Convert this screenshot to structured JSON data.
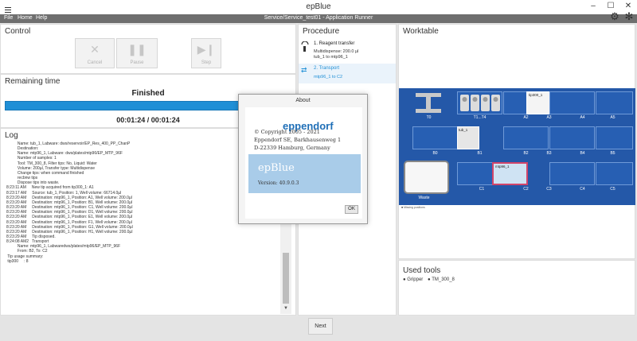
{
  "window": {
    "title": "epBlue",
    "subtitle": "Service/Service_test01 - Application Runner",
    "min": "–",
    "max": "☐",
    "close": "✕"
  },
  "menu": [
    "File",
    "Home",
    "Help"
  ],
  "toolbar_right": {
    "icon1": "run-settings-icon",
    "icon2": "fan-icon"
  },
  "control": {
    "title": "Control",
    "cancel_label": "Cancel",
    "pause_label": "Pause",
    "step_label": "Step"
  },
  "remaining": {
    "title": "Remaining time",
    "status": "Finished",
    "progress": 1.0,
    "times": "00:01:24  /  00:01:24"
  },
  "log": {
    "title": "Log",
    "lines": [
      "          Name: tub_1, Labware: dws/reservoir/EP_Res_400_PP_ChanP",
      "          Destination:",
      "          Name: mtp96_1, Labware: dws/plates/mtp96/EP_MTP_96F",
      "          Number of samples: 1",
      "          Tool: TM_300_8, Filter tips: No, Liquid: Water",
      "          Volume: 200µl, Transfer type: Multidispense",
      "          Change tips: when command finished",
      "          recbnw tips",
      "          Dispose tips into waste.",
      "8:23:11 AM     New tip acquired from tip300_1: A1",
      "8:23:17 AM     Source: tub_1, Position: 1, Well volume: 66714.0µl",
      "8:23:20 AM     Destination: mtp96_1, Position: A1, Well volume: 200.0µl",
      "8:23:20 AM     Destination: mtp96_1, Position: B1, Well volume: 200.0µl",
      "8:23:20 AM     Destination: mtp96_1, Position: C1, Well volume: 200.0µl",
      "8:23:20 AM     Destination: mtp96_1, Position: D1, Well volume: 200.0µl",
      "8:23:20 AM     Destination: mtp96_1, Position: E1, Well volume: 200.0µl",
      "8:23:20 AM     Destination: mtp96_1, Position: F1, Well volume: 200.0µl",
      "8:23:20 AM     Destination: mtp96_1, Position: G1, Well volume: 200.0µl",
      "8:23:20 AM     Destination: mtp96_1, Position: H1, Well volume: 200.0µl",
      "8:23:29 AM     Tip disposed.",
      "8:24:08 AM2   Transport",
      "          Name: mtp96_1, Labwaredws/plates/mtp96/EP_MTP_96F",
      "          From: B2, To: C2",
      "",
      " Tip usage summary:",
      " tip300     : 8"
    ],
    "scroll_up": "▲",
    "scroll_down": "▼"
  },
  "procedure": {
    "title": "Procedure",
    "steps": [
      {
        "title": "1. Reagent transfer",
        "details": [
          "Multidispense: 200.0 µl",
          "tub_1 to mtp96_1"
        ]
      },
      {
        "title": "2. Transport",
        "details": [
          "mtp96_1 to C2"
        ]
      }
    ]
  },
  "worktable": {
    "title": "Worktable",
    "slots": [
      "T0",
      "T1...T4",
      "A2",
      "A3",
      "A4",
      "A5",
      "B0",
      "B1",
      "B2",
      "B3",
      "B4",
      "B5",
      "Waste",
      "C1",
      "C2",
      "C3",
      "C4",
      "C5"
    ],
    "labware": {
      "tip": "tip300_1",
      "tub": "tub_1",
      "plate": "mtp96_1"
    },
    "footnote": "■ Missing positions"
  },
  "used_tools": {
    "title": "Used tools",
    "items": [
      "Gripper",
      "TM_300_8"
    ]
  },
  "next_label": "Next",
  "about": {
    "title": "About",
    "brand": "eppendorf",
    "copyright": "© Copyright 2005 - 2021",
    "company": "Eppendorf SE, Barkhausenweg 1",
    "city": "D-22339 Hamburg, Germany",
    "app_name": "epBlue",
    "version": "Version: 40.9.0.3",
    "ok_label": "OK"
  },
  "colors": {
    "accent": "#1f8fd6",
    "worktable": "#2458a8",
    "brand": "#1f6fb7"
  }
}
